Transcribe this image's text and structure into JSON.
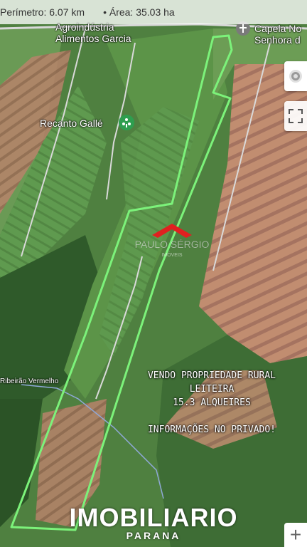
{
  "measure": {
    "perimeter_label": "Perímetro:",
    "perimeter_value": "6.07 km",
    "area_label": "Área:",
    "area_value": "35.03 ha"
  },
  "places": {
    "agro": "Agroindústria",
    "agro2": "Alimentos Garcia",
    "recanto": "Recanto Gallé",
    "capela": "Capela No",
    "capela2": "Senhora d",
    "ribeirao": "Ribeirão Vermelho"
  },
  "watermark": {
    "text": "PAULO SÉRGIO",
    "sub": "IMÓVEIS",
    "color": "#e02020"
  },
  "sale_text": {
    "line1": "VENDO PROPRIEDADE RURAL",
    "line2": "LEITEIRA",
    "line3": "15.3 ALQUEIRES",
    "line4": "INFORMAÇÕES NO PRIVADO!"
  },
  "brand": {
    "name": "IMOBILIARIO",
    "region": "PARANA"
  },
  "controls": {
    "layers_icon": "google-maps-layers-icon",
    "fullscreen_icon": "fullscreen-icon",
    "zoom_in_label": "+"
  },
  "colors": {
    "boundary": "#7cf27a",
    "road": "#e8e8e8"
  }
}
